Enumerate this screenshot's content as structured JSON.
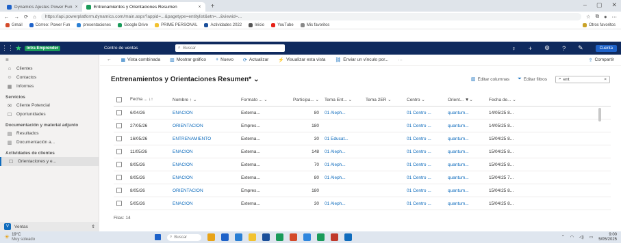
{
  "browser": {
    "tabs": [
      {
        "title": "Dynamics Ajustes Power Fun",
        "active": false,
        "color": "#1e62c9"
      },
      {
        "title": "Entrenamientos y Orientaciones Resumen",
        "active": true,
        "color": "#1a9b5a"
      }
    ],
    "new_tab": "+",
    "url": "https://api.powerplatform.dynamics.com/main.aspx?appid=...&pagetype=entitylist&etn=...&viewid=...",
    "bookmarks": [
      "Gmail",
      "Correo: Power Fun",
      "presentaciones",
      "Google Drive",
      "PRIME PERSONAL",
      "Actividades 2022",
      "Inicio",
      "YouTube",
      "Mis favoritos",
      "Otros favoritos"
    ]
  },
  "app": {
    "brand": "Intra Emprender",
    "area_title": "Centro de ventas",
    "search_placeholder": "Buscar",
    "user_label": "Cuenta"
  },
  "sidebar": {
    "items_top": [
      {
        "icon": "⌂",
        "label": "Clientes"
      },
      {
        "icon": "☺",
        "label": "Contactos"
      },
      {
        "icon": "▦",
        "label": "Informes"
      }
    ],
    "section_services": "Servicios",
    "items_services": [
      {
        "icon": "✉",
        "label": "Cliente Potencial"
      },
      {
        "icon": "☐",
        "label": "Oportunidades"
      }
    ],
    "section_docs": "Documentación y material adjunto",
    "items_docs": [
      {
        "icon": "▤",
        "label": "Resultados"
      },
      {
        "icon": "▥",
        "label": "Documentación a..."
      }
    ],
    "section_activities": "Actividades de clientes",
    "items_activities": [
      {
        "icon": "☐",
        "label": "Orientaciones y e...",
        "active": true
      }
    ],
    "area_badge": "V",
    "area_label": "Ventas"
  },
  "command_bar": {
    "items": [
      "Vista combinada",
      "Mostrar gráfico",
      "Nuevo",
      "Actualizar",
      "Visualizar esta vista",
      "Enviar un vínculo por..."
    ],
    "overflow": "⋯",
    "share": "Compartir"
  },
  "view": {
    "title": "Entrenamientos y Orientaciones Resumen*",
    "edit_columns": "Editar columnas",
    "edit_filters": "Editar filtros",
    "filter_value": "ent"
  },
  "grid": {
    "columns": [
      "Fecha ...  ↓↑",
      "Nombre ↑ ⌄",
      "Formato ... ⌄",
      "Participa... ⌄",
      "Tema Ent... ⌄",
      "Tema 2ER ⌄",
      "Centro ⌄",
      "Orient... ▼⌄",
      "Fecha de... ⌄"
    ],
    "rows": [
      [
        "6/04/26",
        "ENACION",
        "Externa...",
        "80",
        "01 Aleph...",
        "",
        "01 Centro ...",
        "quantum...",
        "14/05/25 8..."
      ],
      [
        "27/05/26",
        "ORIENTACION",
        "Empres...",
        "180",
        "",
        "",
        "01 Centro ...",
        "quantum...",
        "14/05/25 8..."
      ],
      [
        "16/05/26",
        "ENTRENAMIENTO",
        "Externa...",
        "30",
        "01 Educat...",
        "",
        "01 Centro ...",
        "quantum...",
        "15/04/25 8..."
      ],
      [
        "11/05/26",
        "ENACION",
        "Externa...",
        "148",
        "01 Aleph...",
        "",
        "01 Centro ...",
        "quantum...",
        "15/04/25 8..."
      ],
      [
        "8/05/26",
        "ENACION",
        "Externa...",
        "70",
        "01 Aleph...",
        "",
        "01 Centro ...",
        "quantum...",
        "15/04/25 8..."
      ],
      [
        "8/05/26",
        "ENACION",
        "Externa...",
        "80",
        "01 Aleph...",
        "",
        "01 Centro ...",
        "quantum...",
        "15/04/25 7..."
      ],
      [
        "8/05/26",
        "ORIENTACION",
        "Empres...",
        "180",
        "",
        "",
        "01 Centro ...",
        "quantum...",
        "15/04/25 8..."
      ],
      [
        "5/05/26",
        "ENACION",
        "Externa...",
        "30",
        "01 Aleph...",
        "",
        "01 Centro ...",
        "quantum...",
        "15/04/25 8..."
      ]
    ],
    "row_count": "Filas: 14"
  },
  "taskbar": {
    "weather_temp": "19°C",
    "weather_desc": "Muy soleado",
    "search_placeholder": "Buscar",
    "time": "9:00",
    "date": "5/05/2025",
    "app_colors": [
      "#e8a317",
      "#1e62c9",
      "#2a7fd4",
      "#f2c230",
      "#1a4f9a",
      "#1a9b5a",
      "#d44a2a",
      "#2e86de",
      "#1a9b5a",
      "#c0392b",
      "#0f6cbd"
    ]
  }
}
